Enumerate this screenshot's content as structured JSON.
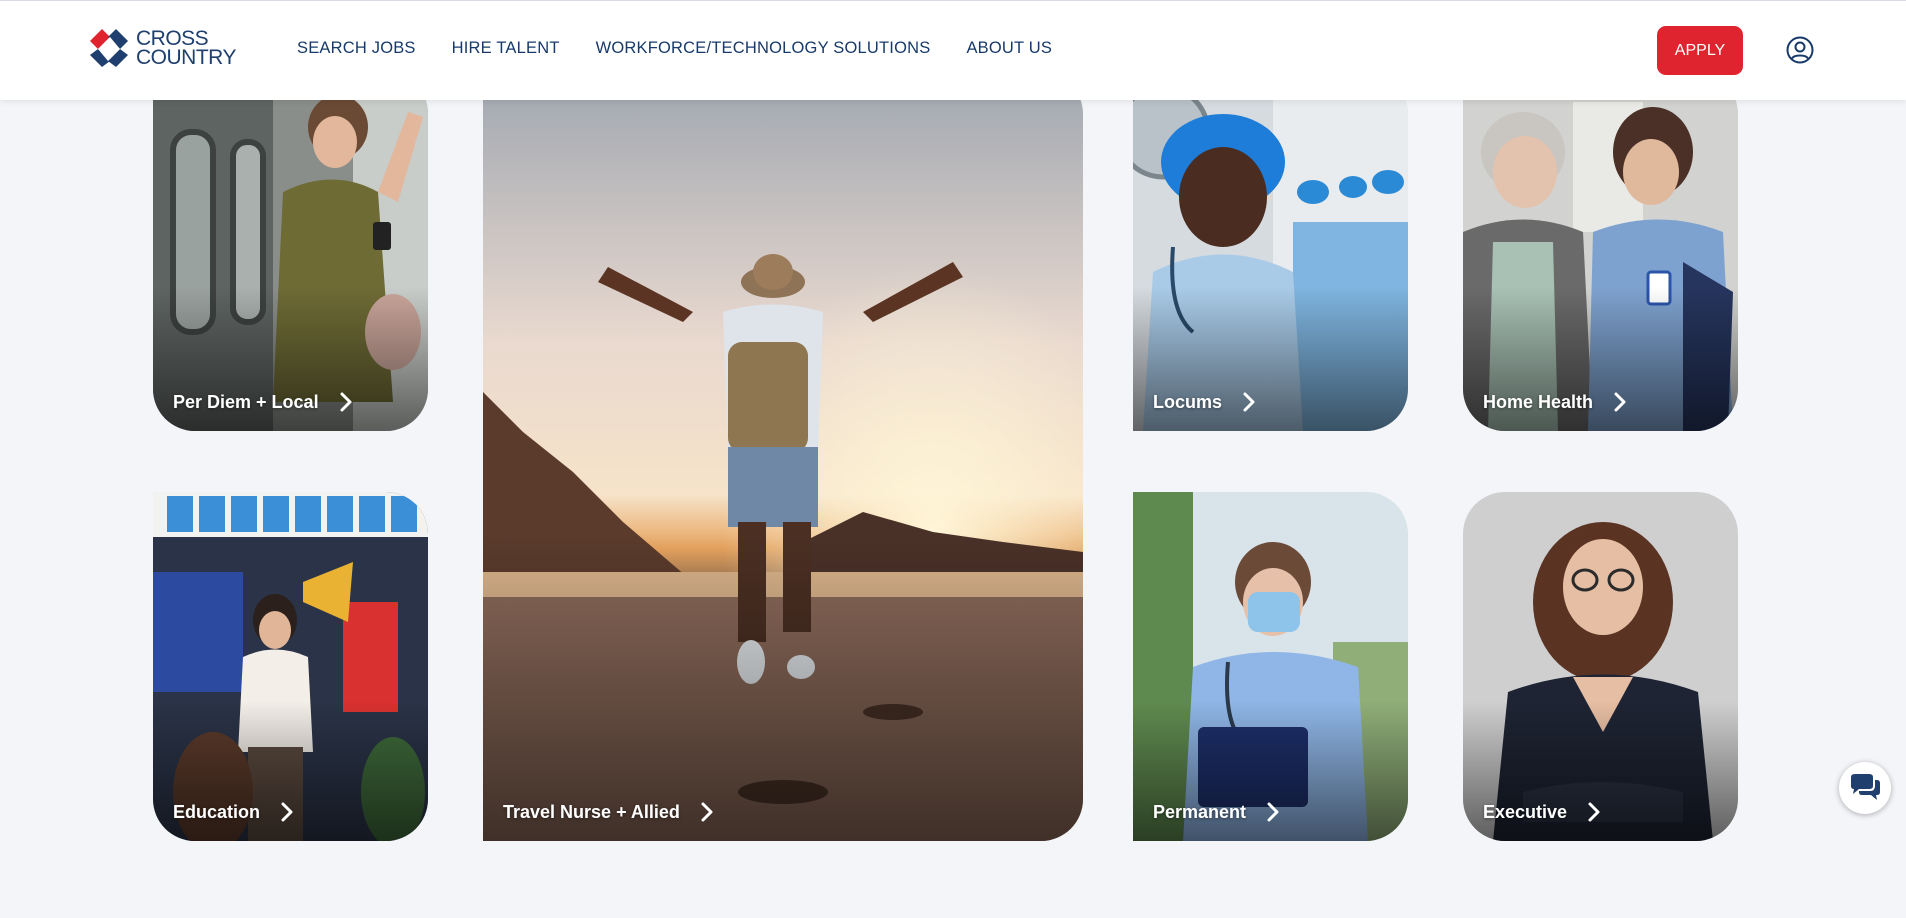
{
  "brand": {
    "name_line1": "CROSS",
    "name_line2": "COUNTRY",
    "primary_color": "#1f3f6e",
    "accent_color": "#e0242f"
  },
  "nav": {
    "items": [
      {
        "label": "SEARCH JOBS"
      },
      {
        "label": "HIRE TALENT"
      },
      {
        "label": "WORKFORCE/TECHNOLOGY SOLUTIONS"
      },
      {
        "label": "ABOUT US"
      }
    ]
  },
  "header": {
    "apply_label": "APPLY",
    "account_icon": "user-circle-icon"
  },
  "tiles": [
    {
      "label": "Per Diem + Local",
      "icon": "chevron-right-icon"
    },
    {
      "label": "Education",
      "icon": "chevron-right-icon"
    },
    {
      "label": "Travel Nurse + Allied",
      "icon": "chevron-right-icon"
    },
    {
      "label": "Locums",
      "icon": "chevron-right-icon"
    },
    {
      "label": "Permanent",
      "icon": "chevron-right-icon"
    },
    {
      "label": "Home Health",
      "icon": "chevron-right-icon"
    },
    {
      "label": "Executive",
      "icon": "chevron-right-icon"
    }
  ],
  "chat": {
    "icon": "chat-bubbles-icon"
  }
}
